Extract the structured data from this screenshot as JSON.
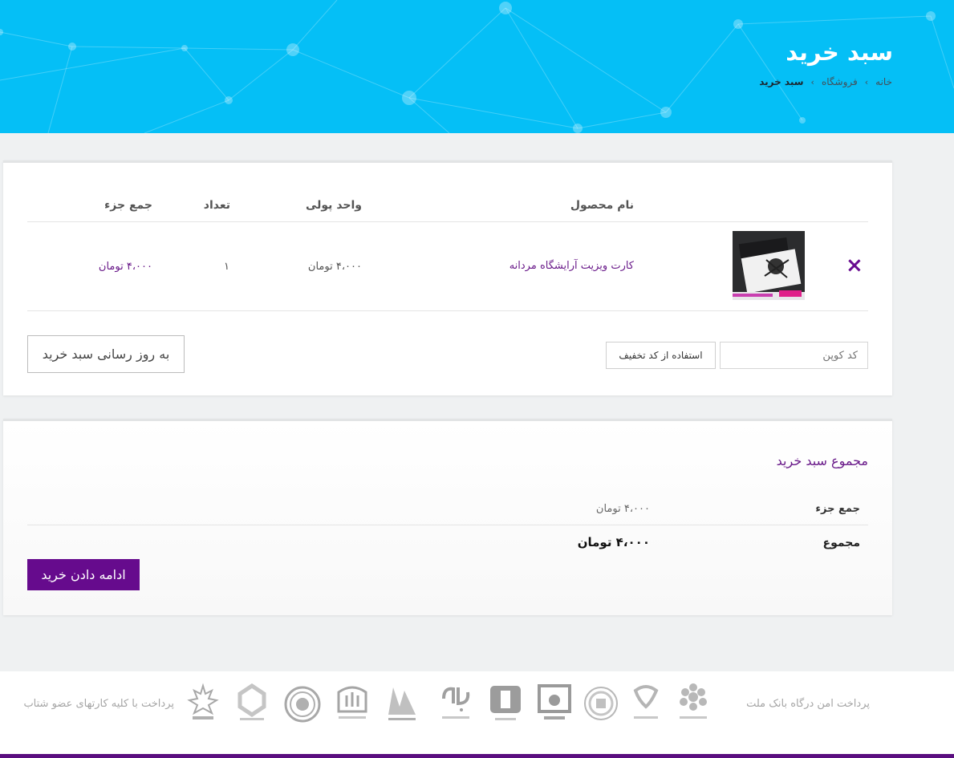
{
  "header": {
    "title": "سبد خرید",
    "breadcrumb": [
      {
        "label": "خانه"
      },
      {
        "label": "فروشگاه"
      },
      {
        "label": "سبد خرید"
      }
    ],
    "sep": "›"
  },
  "cart": {
    "columns": {
      "product": "نام محصول",
      "price": "واحد پولی",
      "quantity": "تعداد",
      "subtotal": "جمع جزء"
    },
    "items": [
      {
        "name": "کارت ویزیت آرایشگاه مردانه",
        "price": "۴،۰۰۰ تومان",
        "quantity": "۱",
        "subtotal": "۴،۰۰۰ تومان"
      }
    ],
    "remove_symbol": "×",
    "coupon_placeholder": "کد کوپن",
    "apply_coupon_label": "استفاده از کد تخفیف",
    "update_cart_label": "به روز رسانی سبد خرید"
  },
  "totals": {
    "title": "مجموع سبد خرید",
    "subtotal_label": "جمع جزء",
    "subtotal_value": "۴،۰۰۰ تومان",
    "total_label": "مجموع",
    "total_value": "۴،۰۰۰ تومان",
    "checkout_label": "ادامه دادن خرید"
  },
  "footer": {
    "secure_payment_text": "پرداخت امن درگاه بانک ملت",
    "all_cards_text": "پرداخت با کلیه کارتهای عضو شتاب",
    "bank_logos": [
      "bank-logo-icon",
      "bank-logo-icon",
      "bank-logo-icon",
      "bank-logo-icon",
      "bank-logo-icon",
      "bank-logo-icon",
      "bank-logo-icon",
      "bank-logo-icon",
      "bank-logo-icon",
      "bank-logo-icon"
    ]
  },
  "colors": {
    "hero": "#05bff6",
    "accent": "#660b8d",
    "link": "#6a1b8a"
  }
}
